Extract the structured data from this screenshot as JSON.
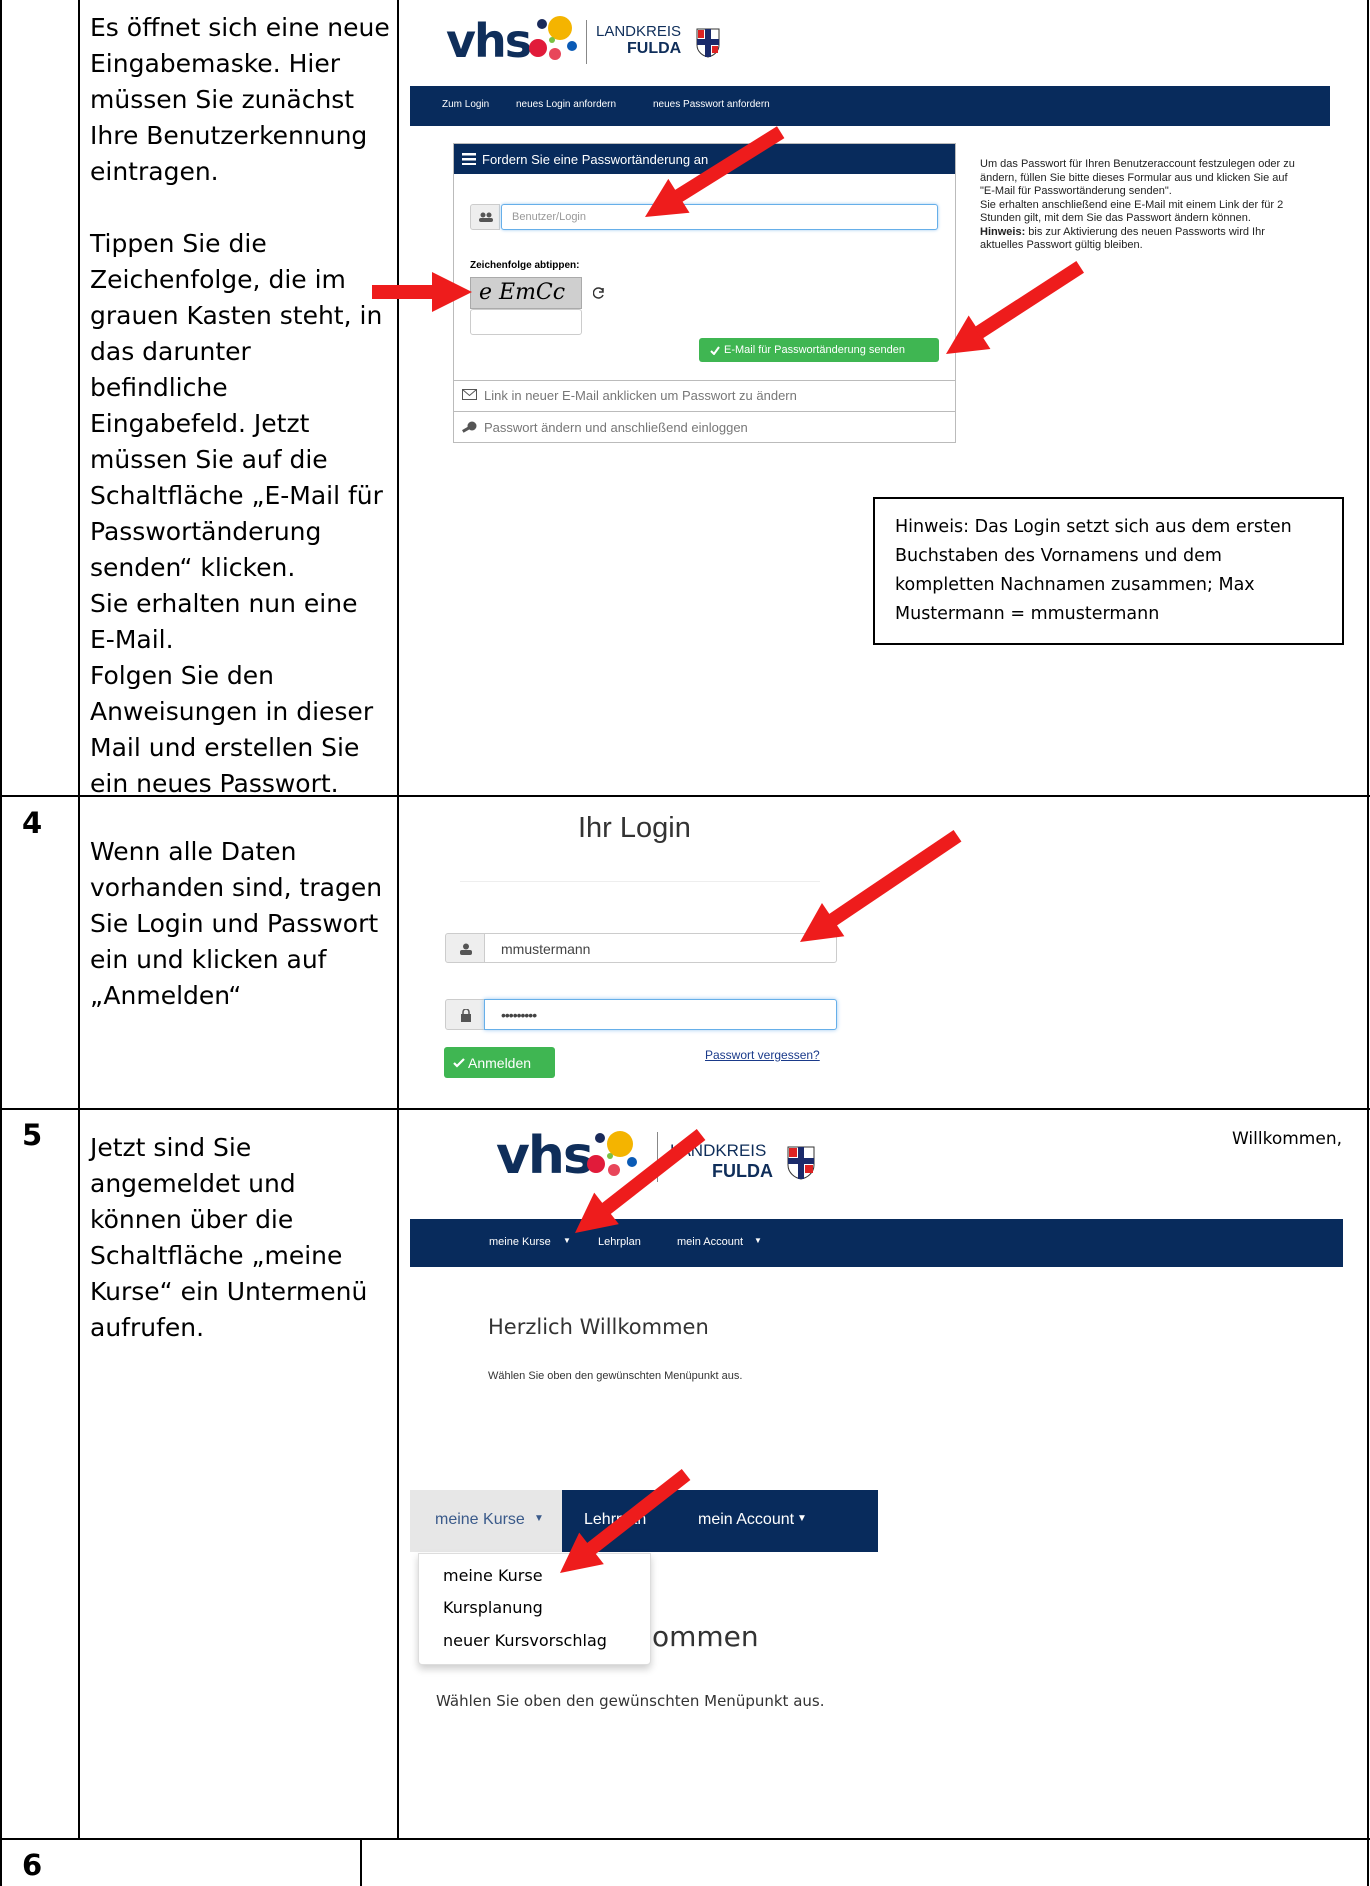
{
  "row3": {
    "instruction": "Es öffnet sich eine neue Eingabemaske. Hier müssen Sie zunächst Ihre Benutzerkennung eintragen.\n\nTippen Sie die Zeichenfolge, die im grauen Kasten steht, in das darunter befindliche Eingabefeld. Jetzt müssen Sie auf die Schaltfläche „E-Mail für Passwortänderung senden“ klicken.\nSie erhalten nun eine E-Mail.\nFolgen Sie den Anweisungen in dieser Mail und erstellen Sie ein neues Passwort.",
    "logo_text": "vhs",
    "logo_landkreis": "LANDKREIS",
    "logo_fulda": "FULDA",
    "nav": [
      "Zum Login",
      "neues Login anfordern",
      "neues Passwort anfordern"
    ],
    "panel_title": "Fordern Sie eine Passwortänderung an",
    "user_placeholder": "Benutzer/Login",
    "captcha_label": "Zeichenfolge abtippen:",
    "captcha_text": "e EmCc",
    "send_button": "E-Mail für Passwortänderung senden",
    "step2": "Link in neuer E-Mail anklicken um Passwort zu ändern",
    "step3": "Passwort ändern und anschließend einloggen",
    "side_text": "Um das Passwort für Ihren Benutzeraccount festzulegen oder zu ändern, füllen Sie bitte dieses Formular aus und klicken Sie auf \"E-Mail für Passwortänderung senden\".\nSie erhalten anschließend eine E-Mail mit einem Link der für 2 Stunden gilt, mit dem Sie das Passwort ändern können.",
    "side_hint_label": "Hinweis:",
    "side_hint_text": " bis zur Aktivierung des neuen Passworts wird Ihr aktuelles Passwort gültig bleiben.",
    "note": "Hinweis: Das Login setzt sich aus dem ersten Buchstaben des Vornamens und dem kompletten Nachnamen zusammen; Max Mustermann = mmustermann"
  },
  "row4": {
    "number": "4",
    "instruction": "Wenn alle Daten vorhanden sind, tragen Sie Login und Passwort ein und klicken auf „Anmelden“",
    "heading": "Ihr Login",
    "login_value": "mmustermann",
    "password_value": "•••••••••",
    "login_button": "Anmelden",
    "forgot_link": "Passwort vergessen?"
  },
  "row5": {
    "number": "5",
    "instruction": "Jetzt sind Sie angemeldet und können über die Schaltfläche „meine Kurse“ ein Untermenü aufrufen.",
    "welcome_top": "Willkommen,",
    "nav": [
      "meine Kurse",
      "Lehrplan",
      "mein Account"
    ],
    "heading": "Herzlich Willkommen",
    "subtext": "Wählen Sie oben den gewünschten Menüpunkt aus.",
    "nav2": [
      "meine Kurse",
      "Lehrplan",
      "mein Account"
    ],
    "dropdown": [
      "meine Kurse",
      "Kursplanung",
      "neuer Kursvorschlag"
    ],
    "heading2_partial": "ommen",
    "subtext2": "Wählen Sie oben den gewünschten Menüpunkt aus."
  },
  "row6": {
    "number": "6"
  },
  "colors": {
    "navy": "#082b5c",
    "arrow": "#ee1c1c",
    "green": "#3fb652",
    "link": "#1a3a8a"
  },
  "icons": [
    "users-icon",
    "refresh-icon",
    "check-icon",
    "envelope-icon",
    "key-icon",
    "user-icon",
    "lock-icon",
    "caret-down-icon",
    "menu-icon"
  ]
}
